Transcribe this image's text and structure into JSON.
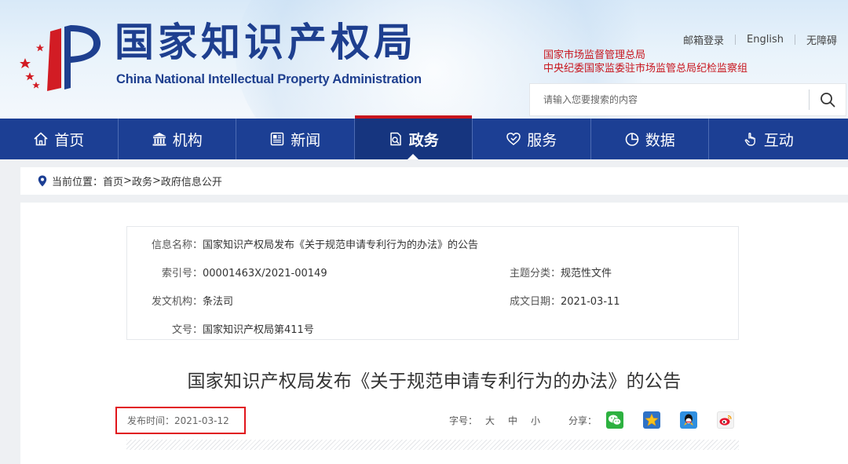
{
  "header": {
    "site_title_cn": "国家知识产权局",
    "site_title_en": "China National Intellectual Property Administration",
    "top_links": [
      "邮箱登录",
      "English",
      "无障碍"
    ],
    "affiliations": [
      "国家市场监督管理总局",
      "中央纪委国家监委驻市场监管总局纪检监察组"
    ],
    "search_placeholder": "请输入您要搜索的内容",
    "brand_color": "#1c3f94",
    "accent_color": "#c8161e"
  },
  "nav": {
    "items": [
      {
        "label": "首页",
        "icon": "home-icon"
      },
      {
        "label": "机构",
        "icon": "institution-icon"
      },
      {
        "label": "新闻",
        "icon": "news-icon"
      },
      {
        "label": "政务",
        "icon": "government-affairs-icon",
        "active": true
      },
      {
        "label": "服务",
        "icon": "service-icon"
      },
      {
        "label": "数据",
        "icon": "data-chart-icon"
      },
      {
        "label": "互动",
        "icon": "interaction-hand-icon"
      }
    ]
  },
  "breadcrumb": {
    "prefix": "当前位置：",
    "items": [
      "首页",
      "政务",
      "政府信息公开"
    ],
    "separator": ">"
  },
  "info": {
    "name_label": "信息名称：",
    "name_value": "国家知识产权局发布《关于规范申请专利行为的办法》的公告",
    "index_label": "索引号：",
    "index_value": "00001463X/2021-00149",
    "topic_label": "主题分类：",
    "topic_value": "规范性文件",
    "issuer_label": "发文机构：",
    "issuer_value": "条法司",
    "date_label": "成文日期：",
    "date_value": "2021-03-11",
    "docno_label": "文号：",
    "docno_value": "国家知识产权局第411号"
  },
  "article": {
    "title": "国家知识产权局发布《关于规范申请专利行为的办法》的公告",
    "publish_time": "发布时间：2021-03-12",
    "font_size_label": "字号：",
    "font_sizes": [
      "大",
      "中",
      "小"
    ],
    "share_label": "分享：",
    "share_targets": [
      "wechat-icon",
      "qzone-icon",
      "qq-icon",
      "weibo-icon"
    ]
  }
}
